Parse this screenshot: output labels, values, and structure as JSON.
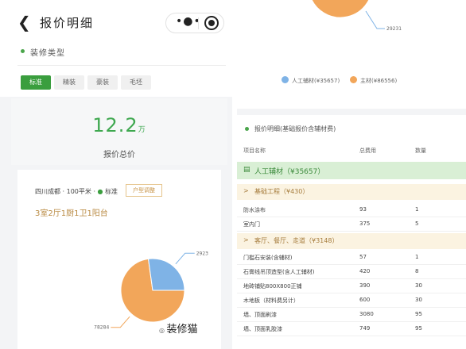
{
  "nav": {
    "back_icon": "back-arrow-icon",
    "title": "报价明细",
    "menu_icon": "more-dots-icon",
    "close_icon": "target-icon"
  },
  "renovation": {
    "label": "装修类型",
    "tabs": [
      {
        "label": "标准",
        "active": true
      },
      {
        "label": "精装",
        "active": false
      },
      {
        "label": "豪装",
        "active": false
      },
      {
        "label": "毛坯",
        "active": false
      }
    ]
  },
  "price": {
    "value": "12.2",
    "unit": "万",
    "label": "报价总价"
  },
  "summary": {
    "location": "四川成都 · 100平米 · ",
    "standard": "标准",
    "type_button": "户型调整",
    "layout": "3室2厅1厨1卫1阳台"
  },
  "chart_data": {
    "type": "pie",
    "values": [
      {
        "name": "人工辅材",
        "label": "78284",
        "value": 78284,
        "color": "#f2a65a"
      },
      {
        "name": "主材",
        "label": "29231",
        "value": 29231,
        "color": "#7fb3e6"
      }
    ],
    "right_labels": [
      "29231"
    ]
  },
  "legend": [
    {
      "label": "人工辅材",
      "value": "35657",
      "color": "#7fb3e6"
    },
    {
      "label": "主材",
      "value": "86556",
      "color": "#f2a65a"
    }
  ],
  "detail": {
    "title": "报价明细(基础报价含辅材费)",
    "headers": [
      "项目名称",
      "总费用",
      "数量"
    ],
    "group_main": "人工辅材（¥35657）",
    "group_a": "基础工程（¥430）",
    "rows_a": [
      {
        "name": "防水涂布",
        "cost": "93",
        "qty": "1"
      },
      {
        "name": "室内门",
        "cost": "375",
        "qty": "5"
      }
    ],
    "group_b": "客厅、餐厅、走道（¥3148）",
    "rows_b": [
      {
        "name": "门槛石安装(含辅材)",
        "cost": "57",
        "qty": "1"
      },
      {
        "name": "石膏线吊顶造型(含人工辅材)",
        "cost": "420",
        "qty": "8"
      },
      {
        "name": "地砖铺贴800X800正铺",
        "cost": "390",
        "qty": "30"
      },
      {
        "name": "木地板（材料费另计）",
        "cost": "600",
        "qty": "30"
      },
      {
        "name": "墙、顶面刷漆",
        "cost": "3080",
        "qty": "95"
      },
      {
        "name": "墙、顶面乳胶漆",
        "cost": "749",
        "qty": "95"
      }
    ]
  },
  "watermark": "装修猫"
}
